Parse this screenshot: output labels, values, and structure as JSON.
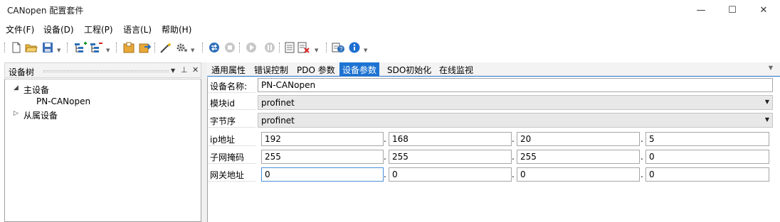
{
  "window": {
    "title": "CANopen 配置套件",
    "controls": {
      "minimize": "—",
      "maximize": "☐",
      "close": "✕"
    }
  },
  "menu": [
    "文件(F)",
    "设备(D)",
    "工程(P)",
    "语言(L)",
    "帮助(H)"
  ],
  "toolbar": {
    "icons": [
      "new-file-icon",
      "open-folder-icon",
      "save-icon",
      "add-device-icon",
      "remove-device-icon",
      "import-icon",
      "export-icon",
      "wizard-icon",
      "settings-icon",
      "connect-icon",
      "stop-icon",
      "start-icon",
      "pause-icon",
      "report-icon",
      "delete-icon",
      "help-icon",
      "info-icon"
    ]
  },
  "device_tree": {
    "title": "设备树",
    "pin": "▾ ⊥ ✕",
    "nodes": {
      "master": "主设备",
      "master_child": "PN-CANopen",
      "slave": "从属设备"
    }
  },
  "tabs": [
    "通用属性",
    "错误控制",
    "PDO 参数",
    "设备参数",
    "SDO初始化",
    "在线监视"
  ],
  "active_tab_index": 3,
  "form": {
    "device_name": {
      "label": "设备名称:",
      "value": "PN-CANopen"
    },
    "module_id": {
      "label": "模块id",
      "value": "profinet"
    },
    "byte_order": {
      "label": "字节序",
      "value": "profinet"
    },
    "ip": {
      "label": "ip地址",
      "octets": [
        "192",
        "168",
        "20",
        "5"
      ]
    },
    "subnet": {
      "label": "子网掩码",
      "octets": [
        "255",
        "255",
        "255",
        "0"
      ]
    },
    "gateway": {
      "label": "网关地址",
      "octets": [
        "0",
        "0",
        "0",
        "0"
      ]
    },
    "separator": "."
  }
}
